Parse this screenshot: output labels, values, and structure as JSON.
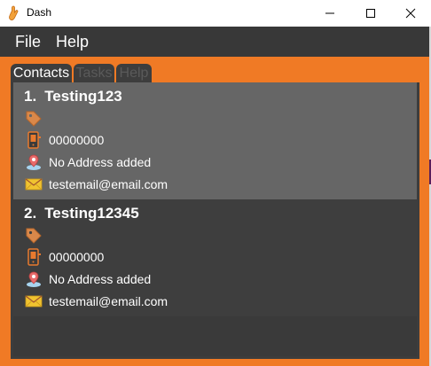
{
  "window": {
    "title": "Dash"
  },
  "menu": {
    "file_label": "File",
    "help_label": "Help"
  },
  "tabs": [
    {
      "label": "Contacts",
      "active": true
    },
    {
      "label": "Tasks",
      "active": false
    },
    {
      "label": "Help",
      "active": false
    }
  ],
  "contacts": [
    {
      "index": "1.",
      "name": "Testing123",
      "phone": "00000000",
      "address": "No Address added",
      "email": "testemail@email.com",
      "selected": true
    },
    {
      "index": "2.",
      "name": "Testing12345",
      "phone": "00000000",
      "address": "No Address added",
      "email": "testemail@email.com",
      "selected": false
    }
  ],
  "icons": {
    "app": "hand-icon",
    "tag": "tag-icon",
    "phone": "phone-icon",
    "address": "location-pin-icon",
    "email": "envelope-icon"
  },
  "colors": {
    "accent": "#f07a25",
    "menubar": "#383838",
    "panel": "#3d3d3d",
    "selected_card": "#666666",
    "tag": "#d9884a"
  }
}
